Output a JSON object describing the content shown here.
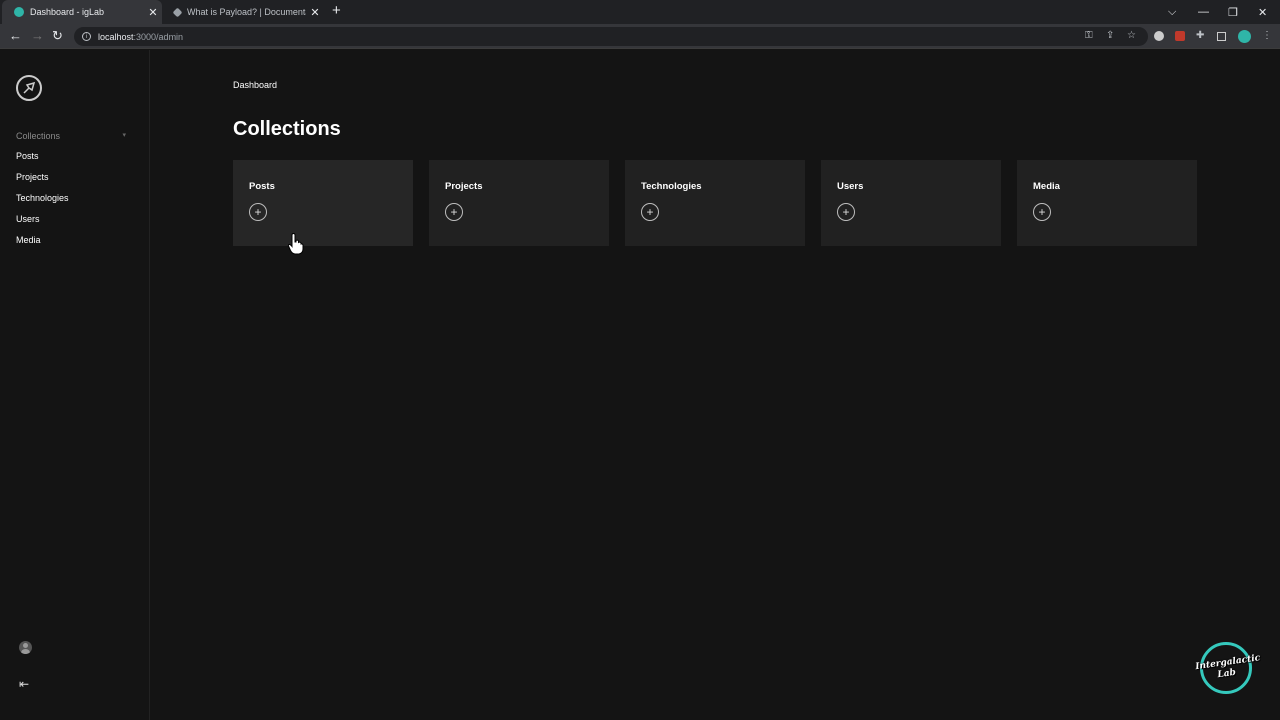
{
  "browser": {
    "tabs": [
      {
        "title": "Dashboard - igLab",
        "active": true
      },
      {
        "title": "What is Payload? | Documentatio",
        "active": false
      }
    ],
    "new_tab": "+",
    "tab_close": "✕",
    "address": {
      "host": "localhost",
      "path": ":3000/admin"
    },
    "window_controls": {
      "dropdown": "⌵",
      "minimize": "—",
      "restore": "❐",
      "close": "✕"
    }
  },
  "sidebar": {
    "heading": "Collections",
    "items": [
      {
        "label": "Posts"
      },
      {
        "label": "Projects"
      },
      {
        "label": "Technologies"
      },
      {
        "label": "Users"
      },
      {
        "label": "Media"
      }
    ]
  },
  "main": {
    "breadcrumb": "Dashboard",
    "title": "Collections",
    "cards": [
      {
        "label": "Posts",
        "add": "+"
      },
      {
        "label": "Projects",
        "add": "+"
      },
      {
        "label": "Technologies",
        "add": "+"
      },
      {
        "label": "Users",
        "add": "+"
      },
      {
        "label": "Media",
        "add": "+"
      }
    ]
  },
  "watermark": {
    "text_line1": "Intergalactic",
    "text_line2": "Lab"
  },
  "colors": {
    "accent": "#2fb5a8",
    "background": "#141414",
    "card": "#212121"
  }
}
